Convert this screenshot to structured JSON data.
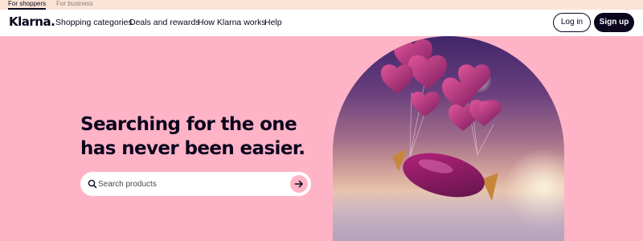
{
  "topbar": {
    "tabs": [
      {
        "label": "For shoppers",
        "active": true
      },
      {
        "label": "For business",
        "active": false
      }
    ]
  },
  "nav": {
    "logo": "Klarna.",
    "links": [
      "Shopping categories",
      "Deals and rewards",
      "How Klarna works",
      "Help"
    ],
    "login": "Log in",
    "signup": "Sign up"
  },
  "hero": {
    "heading_line1": "Searching for the one",
    "heading_line2": "has never been easier.",
    "search": {
      "placeholder": "Search products",
      "value": ""
    },
    "image": "pink-heart-balloons-and-wrapped-candy-above-clouds"
  },
  "icons": {
    "search": "search-icon",
    "submit": "arrow-right-icon"
  },
  "colors": {
    "brand_pink": "#ffb3c7",
    "ink": "#0b051d",
    "topbar": "#fbe3d6",
    "white": "#ffffff"
  }
}
